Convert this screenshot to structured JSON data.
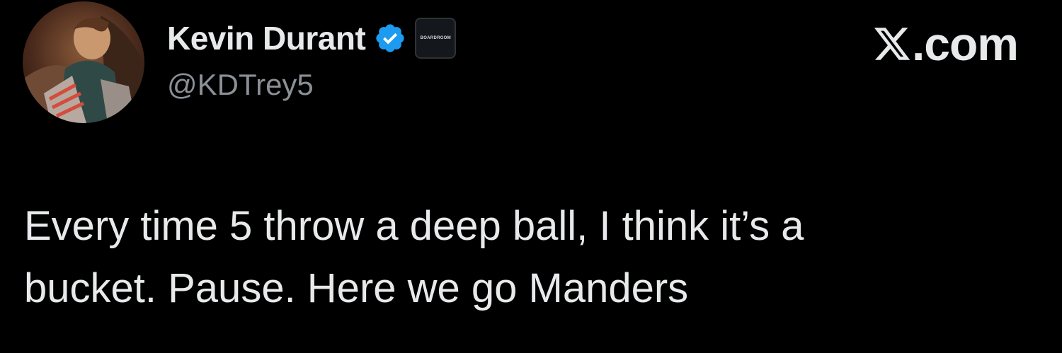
{
  "author": {
    "display_name": "Kevin Durant",
    "handle": "@KDTrey5",
    "verified_icon": "verified-badge-icon",
    "affiliation_badge_text": "BOARDROOM",
    "avatar_icon": "profile-avatar-image"
  },
  "brand": {
    "logo_icon": "x-logo-icon",
    "domain_suffix": ".com"
  },
  "tweet": {
    "text": "Every time 5 throw a deep ball, I think it’s a\nbucket. Pause. Here we go Manders"
  },
  "colors": {
    "background": "#000000",
    "primary_text": "#e7e9ea",
    "secondary_text": "#8b9096",
    "verified_blue": "#1d9bf0"
  }
}
